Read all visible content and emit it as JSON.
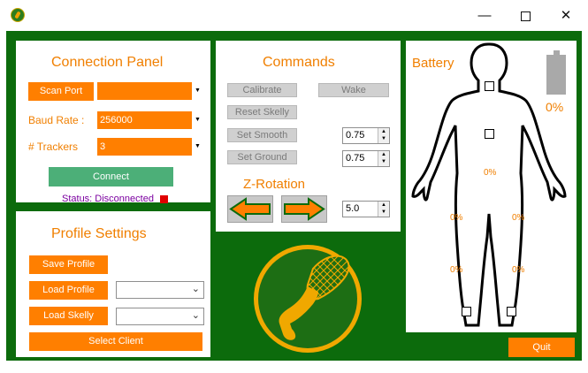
{
  "window": {
    "minimize": "—",
    "close": "✕"
  },
  "connection": {
    "title": "Connection Panel",
    "scan_port_label": "Scan Port",
    "port_value": "",
    "baud_rate_label": "Baud Rate :",
    "baud_rate_value": "256000",
    "trackers_label": "# Trackers",
    "trackers_value": "3",
    "connect_label": "Connect",
    "status_text": "Status: Disconnected",
    "status_color": "#e00000"
  },
  "profile": {
    "title": "Profile Settings",
    "save_label": "Save Profile",
    "load_label": "Load Profile",
    "load_value": "",
    "load_skelly_label": "Load Skelly",
    "load_skelly_value": "",
    "select_client_label": "Select Client"
  },
  "commands": {
    "title": "Commands",
    "calibrate_label": "Calibrate",
    "wake_label": "Wake",
    "reset_label": "Reset Skelly",
    "set_smooth_label": "Set Smooth",
    "smooth_value": "0.75",
    "set_ground_label": "Set Ground",
    "ground_value": "0.75",
    "z_rotation_label": "Z-Rotation",
    "z_rotation_value": "5.0"
  },
  "battery": {
    "title": "Battery",
    "level": "0%",
    "level_fraction": 0,
    "trackers": [
      "0%",
      "0%",
      "0%",
      "0%",
      "0%"
    ]
  },
  "quit_label": "Quit",
  "colors": {
    "accent": "#ff7f00",
    "background": "#0c6b0c",
    "button_disabled": "#d0d0d0"
  }
}
